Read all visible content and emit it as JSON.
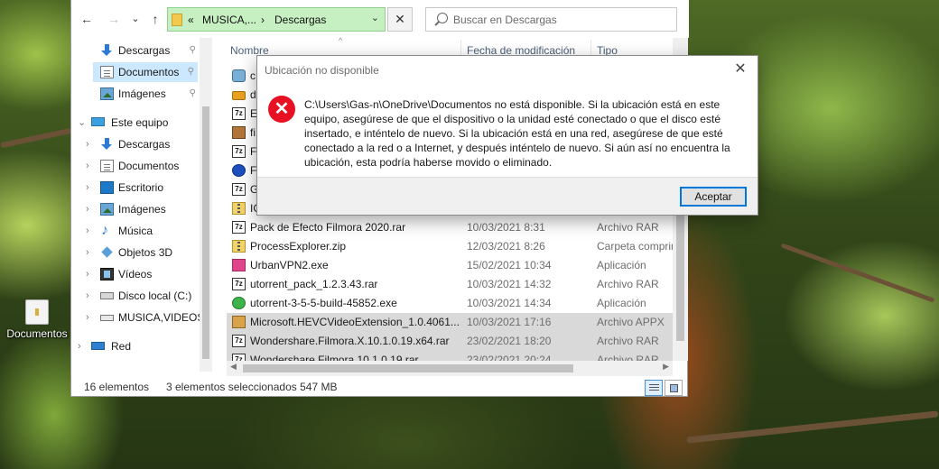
{
  "desktop": {
    "icon_label": "Documentos"
  },
  "explorer": {
    "path": {
      "overflow": "«",
      "crumb1": "MUSICA,...",
      "sep": "›",
      "crumb2": "Descargas",
      "chevron": "⌄"
    },
    "search": {
      "placeholder": "Buscar en Descargas"
    },
    "nav": {
      "back": "←",
      "forward": "→",
      "recent": "⌄",
      "up": "↑",
      "refresh": "✕"
    },
    "sidebar": {
      "pinned": [
        {
          "label": "Descargas",
          "icon": "download-icon"
        },
        {
          "label": "Documentos",
          "icon": "document-icon",
          "selected": true
        },
        {
          "label": "Imágenes",
          "icon": "image-icon"
        }
      ],
      "pin_glyph": "📌",
      "this_pc": "Este equipo",
      "this_pc_items": [
        {
          "label": "Descargas",
          "icon": "download-icon"
        },
        {
          "label": "Documentos",
          "icon": "document-icon"
        },
        {
          "label": "Escritorio",
          "icon": "desktop-icon"
        },
        {
          "label": "Imágenes",
          "icon": "image-icon"
        },
        {
          "label": "Música",
          "icon": "music-icon"
        },
        {
          "label": "Objetos 3D",
          "icon": "objects-3d-icon"
        },
        {
          "label": "Vídeos",
          "icon": "video-icon"
        },
        {
          "label": "Disco local (C:)",
          "icon": "disk-icon"
        },
        {
          "label": "MUSICA,VIDEOS",
          "icon": "drive-icon"
        }
      ],
      "network": "Red"
    },
    "columns": {
      "name": "Nombre",
      "date": "Fecha de modificación",
      "type": "Tipo",
      "sort": "^"
    },
    "files": [
      {
        "name": "c",
        "date": "",
        "type": "",
        "icon": "gear-icon"
      },
      {
        "name": "d",
        "date": "",
        "type": "",
        "icon": "lock-icon"
      },
      {
        "name": "E",
        "date": "",
        "type": "",
        "icon": "rar-icon"
      },
      {
        "name": "fi",
        "date": "",
        "type": "",
        "icon": "pad-icon"
      },
      {
        "name": "Fi",
        "date": "",
        "type": "",
        "icon": "rar-icon"
      },
      {
        "name": "F",
        "date": "",
        "type": "",
        "icon": "circle-icon"
      },
      {
        "name": "G",
        "date": "",
        "type": "",
        "icon": "rar-icon"
      },
      {
        "name": "IC",
        "date": "",
        "type": "",
        "icon": "zip-icon"
      },
      {
        "name": "Pack de Efecto Filmora 2020.rar",
        "date": "10/03/2021 8:31",
        "type": "Archivo RAR",
        "icon": "rar-icon"
      },
      {
        "name": "ProcessExplorer.zip",
        "date": "12/03/2021 8:26",
        "type": "Carpeta comprimida",
        "icon": "zip-icon"
      },
      {
        "name": "UrbanVPN2.exe",
        "date": "15/02/2021 10:34",
        "type": "Aplicación",
        "icon": "pink-app-icon"
      },
      {
        "name": "utorrent_pack_1.2.3.43.rar",
        "date": "10/03/2021 14:32",
        "type": "Archivo RAR",
        "icon": "rar-icon"
      },
      {
        "name": "utorrent-3-5-5-build-45852.exe",
        "date": "10/03/2021 14:34",
        "type": "Aplicación",
        "icon": "green-app-icon"
      },
      {
        "name": "Microsoft.HEVCVideoExtension_1.0.4061...",
        "date": "10/03/2021 17:16",
        "type": "Archivo APPX",
        "icon": "box-icon",
        "selected": true
      },
      {
        "name": "Wondershare.Filmora.X.10.1.0.19.x64.rar",
        "date": "23/02/2021 18:20",
        "type": "Archivo RAR",
        "icon": "rar-icon",
        "selected": true
      },
      {
        "name": "Wondershare.Filmora.10.1.0.19.rar",
        "date": "23/02/2021 20:24",
        "type": "Archivo RAR",
        "icon": "rar-icon",
        "selected": true
      }
    ],
    "status": {
      "count": "16 elementos",
      "selection": "3 elementos seleccionados  547 MB"
    }
  },
  "dialog": {
    "title": "Ubicación no disponible",
    "close": "✕",
    "error_glyph": "✕",
    "message": "C:\\Users\\Gas-n\\OneDrive\\Documentos no está disponible. Si la ubicación está en este equipo, asegúrese de que el dispositivo o la unidad esté conectado o que el disco esté insertado, e inténtelo de nuevo. Si la ubicación está en una red, asegúrese de que esté conectado a la red o a Internet, y después inténtelo de nuevo. Si aún así no encuentra la ubicación, esta podría haberse movido o eliminado.",
    "ok_label": "Aceptar"
  }
}
